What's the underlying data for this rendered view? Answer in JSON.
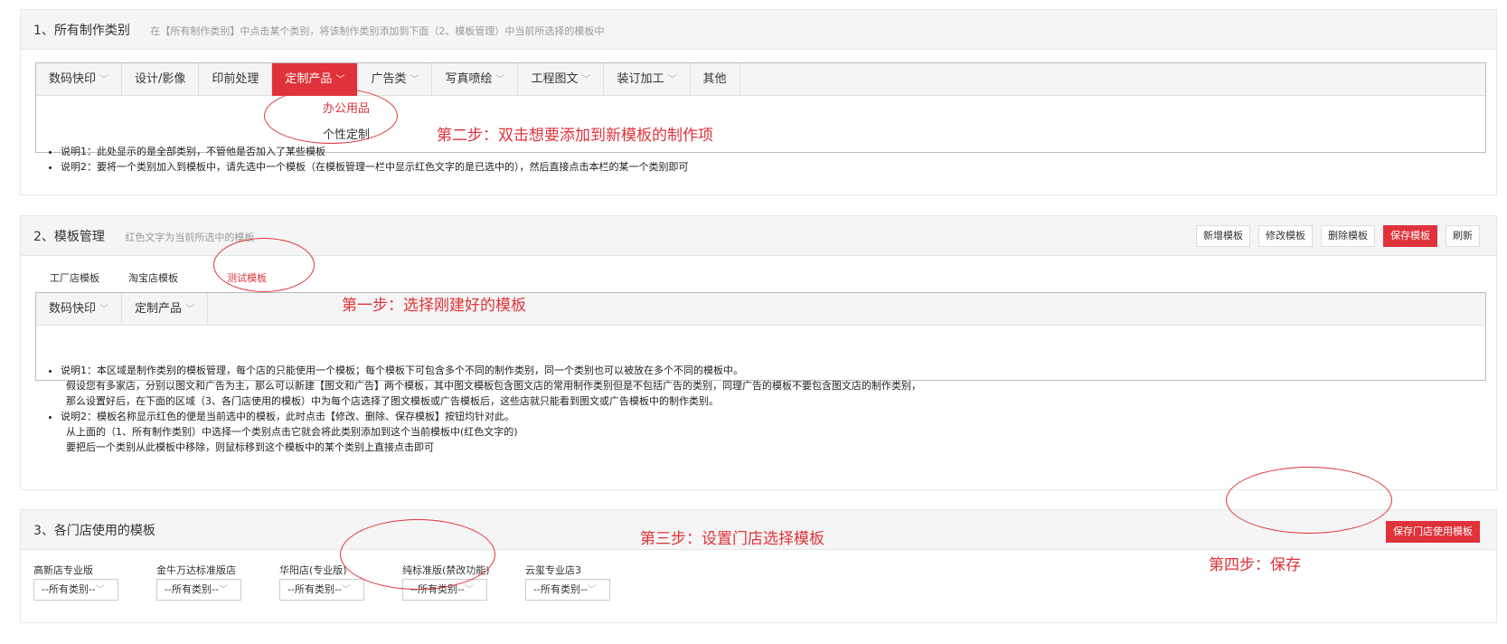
{
  "section1": {
    "title": "1、所有制作类别",
    "hint": "在【所有制作类别】中点击某个类别，将该制作类别添加到下面（2、模板管理）中当前所选择的模板中",
    "tabs": [
      "数码快印",
      "设计/影像",
      "印前处理",
      "定制产品",
      "广告类",
      "写真喷绘",
      "工程图文",
      "装订加工",
      "其他"
    ],
    "active_tab": "定制产品",
    "dropdown": [
      "办公用品",
      "个性定制"
    ],
    "notes": [
      "说明1：此处显示的是全部类别，不管他是否加入了某些模板",
      "说明2：要将一个类别加入到模板中，请先选中一个模板（在模板管理一栏中显示红色文字的是已选中的），然后直接点击本栏的某一个类别即可"
    ],
    "annotation": "第二步：双击想要添加到新模板的制作项"
  },
  "section2": {
    "title": "2、模板管理",
    "hint": "红色文字为当前所选中的模板",
    "buttons": {
      "add": "新增模板",
      "edit": "修改模板",
      "delete": "删除模板",
      "save": "保存模板",
      "refresh": "刷新"
    },
    "templates": [
      "工厂店模板",
      "淘宝店模板",
      "测试模板"
    ],
    "selected_template": "测试模板",
    "categories": [
      "数码快印",
      "定制产品"
    ],
    "notes": {
      "n1_line1": "说明1：本区域是制作类别的模板管理，每个店的只能使用一个模板；每个模板下可包含多个不同的制作类别，同一个类别也可以被放在多个不同的模板中。",
      "n1_line2": "假设您有多家店，分别以图文和广告为主，那么可以新建【图文和广告】两个模板，其中图文模板包含图文店的常用制作类别但是不包括广告的类别，同理广告的模板不要包含图文店的制作类别，",
      "n1_line3": "那么设置好后，在下面的区域（3、各门店使用的模板）中为每个店选择了图文模板或广告模板后，这些店就只能看到图文或广告模板中的制作类别。",
      "n2_line1": "说明2：模板名称显示红色的便是当前选中的模板，此时点击【修改、删除、保存模板】按钮均针对此。",
      "n2_line2": "从上面的（1、所有制作类别）中选择一个类别点击它就会将此类别添加到这个当前模板中(红色文字的)",
      "n2_line3": "要把后一个类别从此模板中移除，则鼠标移到这个模板中的某个类别上直接点击即可"
    },
    "annotation": "第一步：选择刚建好的模板"
  },
  "section3": {
    "title": "3、各门店使用的模板",
    "save_button": "保存门店使用模板",
    "shops": [
      {
        "name": "高新店专业版",
        "value": "--所有类别--"
      },
      {
        "name": "金牛万达标准版店",
        "value": "--所有类别--"
      },
      {
        "name": "华阳店(专业版)",
        "value": "--所有类别--"
      },
      {
        "name": "纯标准版(禁改功能)",
        "value": "--所有类别--"
      },
      {
        "name": "云玺专业店3",
        "value": "--所有类别--"
      }
    ],
    "annotation_step3": "第三步：设置门店选择模板",
    "annotation_step4": "第四步：保存"
  },
  "colors": {
    "accent": "#e0323a",
    "panel_bg": "#f5f5f5"
  },
  "icons": {
    "dropdown": "chevron-down-icon"
  }
}
